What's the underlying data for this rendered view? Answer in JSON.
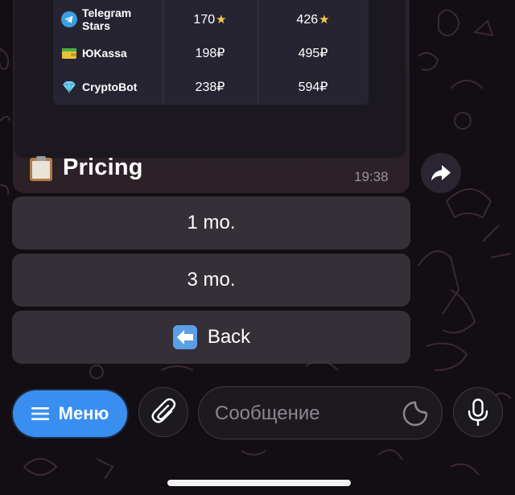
{
  "pricing_table": {
    "rows": [
      {
        "provider": "Telegram Stars",
        "price_1": "170",
        "price_2": "426",
        "currency_icon": "star-icon"
      },
      {
        "provider": "ЮKassa",
        "price_1": "198₽",
        "price_2": "495₽",
        "currency_icon": ""
      },
      {
        "provider": "CryptoBot",
        "price_1": "238₽",
        "price_2": "594₽",
        "currency_icon": ""
      }
    ]
  },
  "message": {
    "caption": "Pricing",
    "caption_icon": "clipboard-icon",
    "time": "19:38"
  },
  "keyboard": {
    "buttons": [
      {
        "label": "1 mo."
      },
      {
        "label": "3 mo."
      },
      {
        "label": "Back",
        "icon": "back-arrow-icon"
      }
    ]
  },
  "input_bar": {
    "menu_label": "Меню",
    "placeholder": "Сообщение"
  },
  "colors": {
    "accent": "#3a8ef0",
    "background": "#120e14",
    "bubble": "#2b2230",
    "button": "#3a343c"
  }
}
